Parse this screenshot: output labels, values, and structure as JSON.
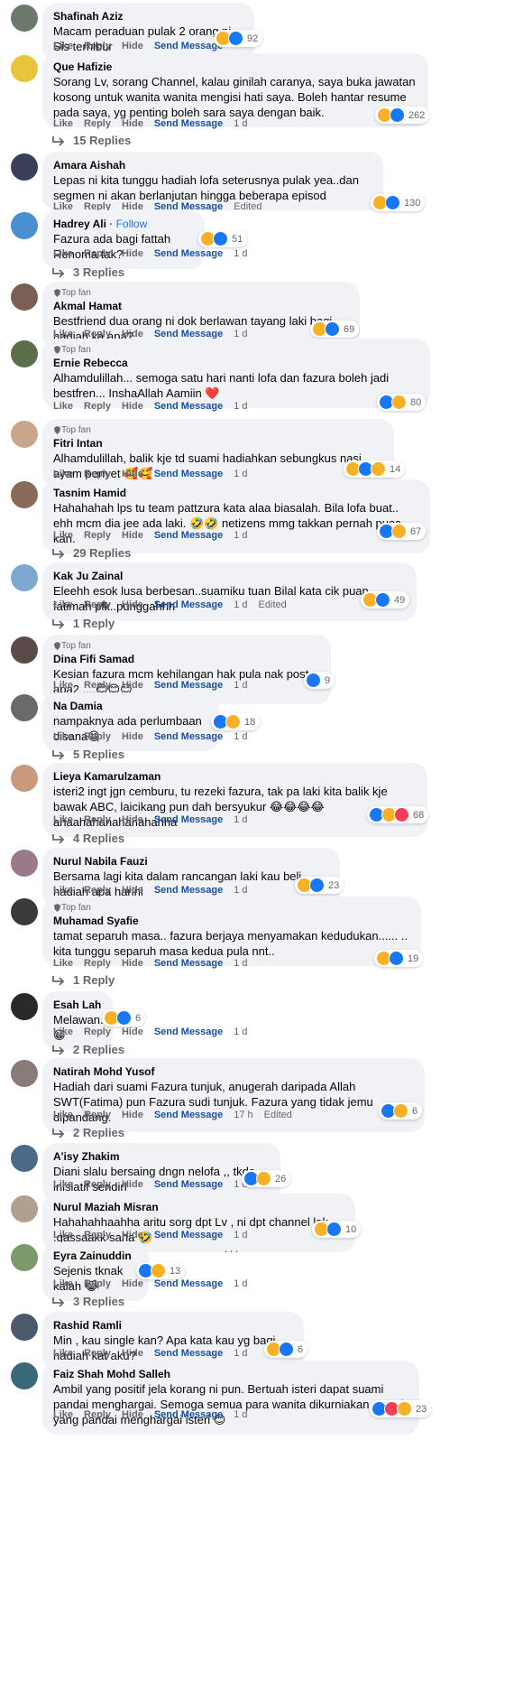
{
  "actions": {
    "like": "Like",
    "reply": "Reply",
    "hide": "Hide",
    "send": "Send Message",
    "edited": "Edited"
  },
  "comments": [
    {
      "name": "Shafinah Aziz",
      "text": "Macam peraduan pulak 2 orang ni. Sis terhibur",
      "time": "",
      "reactions": [
        "haha",
        "like"
      ],
      "count": "92"
    },
    {
      "name": "Que Hafizie",
      "text": "Sorang Lv, sorang Channel, kalau ginilah caranya, saya buka jawatan kosong untuk wanita wanita mengisi hati saya. Boleh hantar resume pada saya, yg penting boleh sara saya dengan baik.",
      "time": "1 d",
      "reactions": [
        "haha",
        "like"
      ],
      "count": "262",
      "replies": "15 Replies"
    },
    {
      "name": "Amara Aishah",
      "text": "Lepas ni kita tunggu hadiah lofa seterusnya pulak yea..dan segmen ni akan berlanjutan hingga beberapa episod",
      "time": "",
      "edited": true,
      "reactions": [
        "haha",
        "like"
      ],
      "count": "130"
    },
    {
      "name": "Hadrey Ali",
      "follow": "Follow",
      "text": "Fazura ada bagi fattah Renoma tak?",
      "time": "1 d",
      "reactions": [
        "haha",
        "like"
      ],
      "count": "51",
      "replies": "3 Replies"
    },
    {
      "topfan": "Top fan",
      "name": "Akmal Hamat",
      "text": "Bestfriend dua orang ni dok berlawan tayang laki bagi hadiah ka apa?",
      "time": "1 d",
      "reactions": [
        "haha",
        "like"
      ],
      "count": "69"
    },
    {
      "topfan": "Top fan",
      "name": "Ernie Rebecca",
      "text": "Alhamdulillah... semoga satu hari nanti lofa dan fazura boleh jadi bestfren... InshaAllah Aamiin ❤️",
      "time": "1 d",
      "reactions": [
        "like",
        "haha"
      ],
      "count": "80"
    },
    {
      "topfan": "Top fan",
      "name": "Fitri Intan",
      "text": "Alhamdulillah, balik kje td suami hadiahkan sebungkus nasi ayam penyet 🥰🥰",
      "time": "1 d",
      "reactions": [
        "haha",
        "like",
        "care"
      ],
      "count": "14"
    },
    {
      "name": "Tasnim Hamid",
      "text": "Hahahahah lps tu team pattzura kata alaa biasalah. Bila lofa buat.. ehh mcm dia jee ada laki. 🤣🤣 netizens mmg takkan pernah puas kan.",
      "time": "1 d",
      "reactions": [
        "like",
        "haha"
      ],
      "count": "67",
      "replies": "29 Replies"
    },
    {
      "name": "Kak Ju Zainal",
      "text": "Eleehh esok lusa berbesan..suamiku tuan Bilal kata cik puan fatimah plk..punggahhh",
      "time": "1 d",
      "edited": true,
      "reactions": [
        "haha",
        "like"
      ],
      "count": "49",
      "replies": "1 Reply"
    },
    {
      "topfan": "Top fan",
      "name": "Dina Fifi Samad",
      "text": "Kesian fazura mcm kehilangan hak pula nak post apa2 ....😊😊😊",
      "time": "1 d",
      "reactions": [
        "like"
      ],
      "count": "9"
    },
    {
      "name": "Na Damia",
      "text": "nampaknya ada perlumbaan disana😁",
      "time": "1 d",
      "reactions": [
        "like",
        "haha"
      ],
      "count": "18",
      "replies": "5 Replies"
    },
    {
      "name": "Lieya Kamarulzaman",
      "text": "isteri2 ingt jgn cemburu, tu rezeki fazura, tak pa laki kita balik kje bawak ABC, laicikang pun dah bersyukur 😂😂😂😂 ahaahahahahahahahha",
      "time": "1 d",
      "reactions": [
        "like",
        "haha",
        "love"
      ],
      "count": "68",
      "replies": "4 Replies"
    },
    {
      "name": "Nurul Nabila Fauzi",
      "text": "Bersama lagi kita dalam rancangan laki kau beli hadiah apa harini",
      "time": "1 d",
      "reactions": [
        "haha",
        "like"
      ],
      "count": "23"
    },
    {
      "topfan": "Top fan",
      "name": "Muhamad Syafie",
      "text": "tamat separuh masa.. fazura berjaya menyamakan kedudukan...... .. kita tunggu separuh masa kedua pula nnt..",
      "time": "1 d",
      "reactions": [
        "haha",
        "like"
      ],
      "count": "19",
      "replies": "1 Reply"
    },
    {
      "name": "Esah Lah",
      "text": "Melawan.....😁",
      "time": "1 d",
      "reactions": [
        "haha",
        "like"
      ],
      "count": "6",
      "replies": "2 Replies"
    },
    {
      "name": "Natirah Mohd Yusof",
      "text": "Hadiah dari suami Fazura tunjuk, anugerah daripada Allah SWT(Fatima) pun Fazura sudi tunjuk. Fazura yang tidak jemu dipandang.",
      "time": "17 h",
      "edited": true,
      "reactions": [
        "like",
        "haha"
      ],
      "count": "6",
      "replies": "2 Replies"
    },
    {
      "name": "A'isy Zhakim",
      "text": "Diani slalu bersaing dngn nelofa ,, tkde inisiatif sendiri",
      "time": "1 d",
      "reactions": [
        "like",
        "haha"
      ],
      "count": "26"
    },
    {
      "name": "Nurul Maziah Misran",
      "text": "Hahahahhaahha aritu sorg dpt Lv , ni dpt channel lak .gassaakk sana 🤣",
      "time": "1 d",
      "reactions": [
        "haha",
        "like"
      ],
      "count": "10"
    },
    {
      "name": "Eyra Zainuddin",
      "text": "Sejenis tknak kalah 😹",
      "time": "1 d",
      "reactions": [
        "like",
        "haha"
      ],
      "count": "13",
      "replies": "3 Replies"
    },
    {
      "name": "Rashid Ramli",
      "text": "Min , kau single kan? Apa kata kau yg bagi hadiah kat aku?",
      "time": "1 d",
      "reactions": [
        "haha",
        "like"
      ],
      "count": "6"
    },
    {
      "name": "Faiz Shah Mohd Salleh",
      "text": "Ambil yang positif jela korang ni pun. Bertuah isteri dapat suami pandai menghargai. Semoga semua para wanita dikurniakan suami yang pandai menghargai isteri 😊",
      "time": "1 d",
      "reactions": [
        "like",
        "love",
        "haha"
      ],
      "count": "23"
    }
  ],
  "colors": {
    "bubble": "#f0f2f5",
    "link": "#1a4fa0",
    "muted": "#65676b",
    "like": "#1877f2",
    "haha": "#f7b125",
    "love": "#f33e58"
  }
}
